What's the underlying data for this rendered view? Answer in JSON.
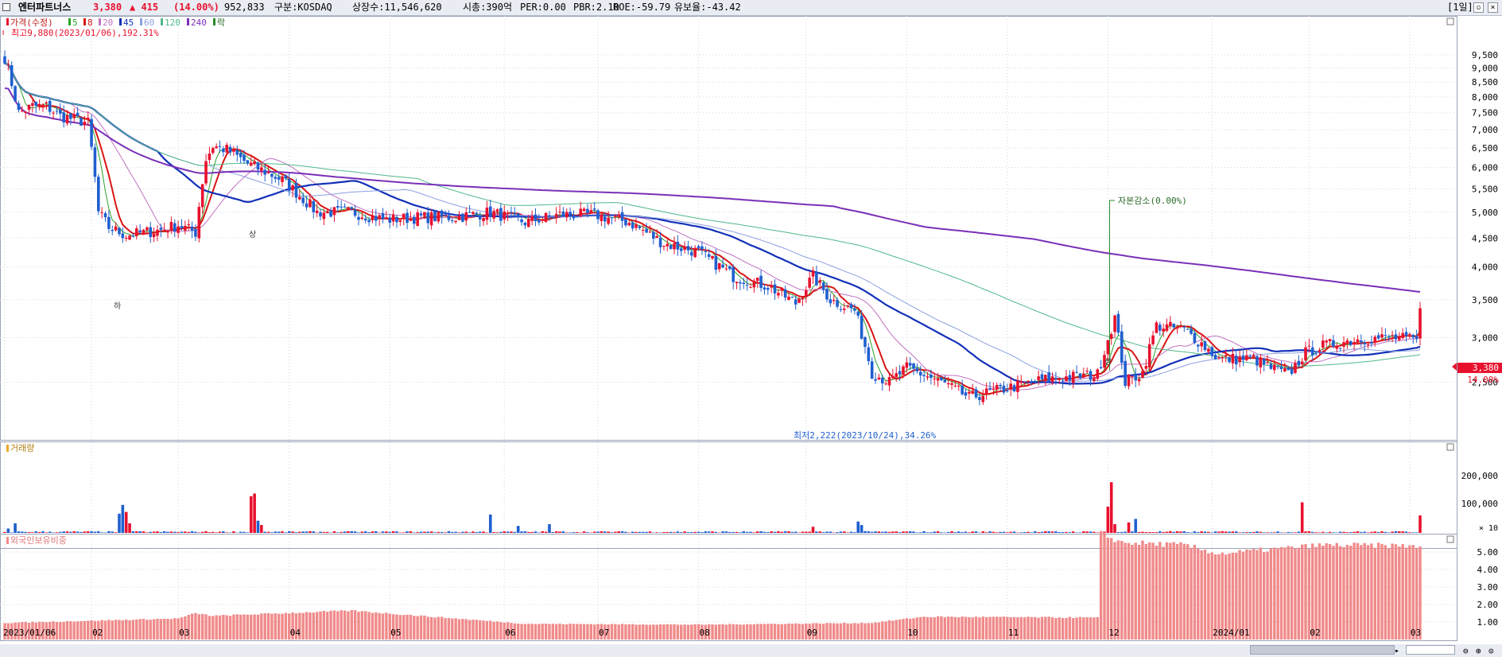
{
  "header": {
    "stock_name": "엔터파트너스",
    "price": "3,380",
    "change": "▲ 415",
    "change_pct": "(14.00%)",
    "volume": "952,833",
    "market": "구분:KOSDAQ",
    "shares": "상장수:11,546,620",
    "market_cap": "시총:390억",
    "per": "PER:0.00",
    "pbr": "PBR:2.10",
    "roe": "ROE:-59.79",
    "float_ratio": "유보율:-43.42",
    "period_button": "[1일]"
  },
  "colors": {
    "up": "#e8112d",
    "down": "#1f5fcf",
    "ma5": "#2aa12a",
    "ma8": "#d91515",
    "ma20": "#c071c0",
    "ma45": "#1230b8",
    "ma60": "#8aa0e0",
    "ma120": "#4fb889",
    "ma240": "#7a2fb8",
    "foreign_bar": "#f08a8a",
    "grid": "#cfd6e2"
  },
  "legend": {
    "price_label": "가격(수정)",
    "ma_periods": [
      "5",
      "8",
      "20",
      "45",
      "60",
      "120",
      "240"
    ],
    "extra": "락"
  },
  "annotations": {
    "high": "최고9,880(2023/01/06),192.31%",
    "low": "최저2,222(2023/10/24),34.26%",
    "capital_reduction": "자본감소(0.00%)",
    "upper_limit_marks": [
      "상",
      "상"
    ],
    "lower_limit_mark": "하"
  },
  "price_axis": {
    "labels": [
      "9,500",
      "9,000",
      "8,500",
      "8,000",
      "7,500",
      "7,000",
      "6,500",
      "6,000",
      "5,500",
      "5,000",
      "4,500",
      "4,000",
      "3,500",
      "3,000",
      "2,500"
    ],
    "current_price": "3,380",
    "current_pct": "14.00%"
  },
  "volume_panel": {
    "title": "거래량",
    "axis_labels": [
      "200,000",
      "100,000"
    ],
    "unit": "× 10"
  },
  "foreign_panel": {
    "title": "외국인보유비중",
    "axis_labels": [
      "5.00",
      "4.00",
      "3.00",
      "2.00",
      "1.00"
    ]
  },
  "date_axis": {
    "labels": [
      "2023/01/06",
      "02",
      "03",
      "04",
      "05",
      "06",
      "07",
      "08",
      "09",
      "10",
      "11",
      "12",
      "2024/01",
      "02",
      "03"
    ]
  },
  "chart_data": {
    "type": "candlestick",
    "start_date": "2023/01/06",
    "ylim": [
      2200,
      10000
    ],
    "price_anchors": [
      [
        0,
        9400
      ],
      [
        4,
        7500
      ],
      [
        8,
        7700
      ],
      [
        12,
        7700
      ],
      [
        16,
        7400
      ],
      [
        20,
        7300
      ],
      [
        24,
        7200
      ],
      [
        27,
        5000
      ],
      [
        30,
        4700
      ],
      [
        35,
        4550
      ],
      [
        40,
        4600
      ],
      [
        45,
        4650
      ],
      [
        50,
        4750
      ],
      [
        55,
        4600
      ],
      [
        58,
        6200
      ],
      [
        60,
        6550
      ],
      [
        64,
        6450
      ],
      [
        70,
        6100
      ],
      [
        75,
        5900
      ],
      [
        80,
        5700
      ],
      [
        85,
        5350
      ],
      [
        90,
        5000
      ],
      [
        100,
        5000
      ],
      [
        110,
        4850
      ],
      [
        120,
        4900
      ],
      [
        130,
        4900
      ],
      [
        140,
        5000
      ],
      [
        150,
        4800
      ],
      [
        160,
        4950
      ],
      [
        170,
        4950
      ],
      [
        180,
        4800
      ],
      [
        190,
        4400
      ],
      [
        200,
        4250
      ],
      [
        210,
        3850
      ],
      [
        220,
        3700
      ],
      [
        228,
        3450
      ],
      [
        233,
        3850
      ],
      [
        238,
        3500
      ],
      [
        245,
        3350
      ],
      [
        250,
        2600
      ],
      [
        255,
        2500
      ],
      [
        260,
        2650
      ],
      [
        270,
        2500
      ],
      [
        278,
        2350
      ],
      [
        290,
        2450
      ],
      [
        300,
        2530
      ],
      [
        315,
        2580
      ],
      [
        320,
        3250
      ],
      [
        323,
        2500
      ],
      [
        328,
        2600
      ],
      [
        332,
        3150
      ],
      [
        340,
        3100
      ],
      [
        350,
        2750
      ],
      [
        360,
        2750
      ],
      [
        365,
        2650
      ],
      [
        370,
        2580
      ],
      [
        375,
        2820
      ],
      [
        380,
        2900
      ],
      [
        390,
        2980
      ],
      [
        400,
        3000
      ],
      [
        407,
        2965
      ],
      [
        408,
        3380
      ]
    ],
    "volume_spikes": [
      [
        1,
        25
      ],
      [
        3,
        55
      ],
      [
        33,
        110
      ],
      [
        34,
        160
      ],
      [
        35,
        120
      ],
      [
        36,
        55
      ],
      [
        71,
        210
      ],
      [
        72,
        225
      ],
      [
        73,
        70
      ],
      [
        74,
        45
      ],
      [
        140,
        105
      ],
      [
        148,
        40
      ],
      [
        157,
        50
      ],
      [
        233,
        35
      ],
      [
        246,
        65
      ],
      [
        247,
        45
      ],
      [
        318,
        150
      ],
      [
        319,
        290
      ],
      [
        320,
        50
      ],
      [
        324,
        60
      ],
      [
        326,
        80
      ],
      [
        374,
        175
      ],
      [
        408,
        100
      ]
    ],
    "foreign_holding_levels": [
      [
        0,
        0.95
      ],
      [
        50,
        1.2
      ],
      [
        55,
        1.5
      ],
      [
        60,
        1.35
      ],
      [
        100,
        1.65
      ],
      [
        150,
        0.9
      ],
      [
        200,
        0.85
      ],
      [
        250,
        0.95
      ],
      [
        265,
        1.3
      ],
      [
        315,
        1.25
      ],
      [
        316,
        6.05
      ],
      [
        322,
        5.55
      ],
      [
        340,
        5.4
      ],
      [
        350,
        4.9
      ],
      [
        380,
        5.4
      ],
      [
        408,
        5.35
      ]
    ],
    "ma_series": [
      "5",
      "8",
      "20",
      "45",
      "60",
      "120",
      "240"
    ]
  }
}
